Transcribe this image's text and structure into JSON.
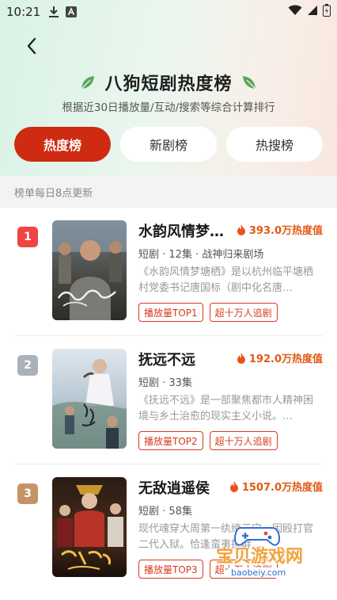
{
  "status_bar": {
    "time": "10:21",
    "icons": [
      "download-icon",
      "text-a-icon",
      "wifi-icon",
      "signal-icon",
      "battery-charging-icon"
    ]
  },
  "header": {
    "title": "八狗短剧热度榜",
    "subtitle": "根据近30日播放量/互动/搜索等综合计算排行",
    "accent_color": "#cf2a12"
  },
  "tabs": [
    {
      "label": "热度榜",
      "active": true
    },
    {
      "label": "新剧榜",
      "active": false
    },
    {
      "label": "热搜榜",
      "active": false
    }
  ],
  "update_note": "榜单每日8点更新",
  "items": [
    {
      "rank": "1",
      "rank_color": "#f04343",
      "title": "水韵风情梦塘栖",
      "heat": "393.0万热度值",
      "meta": "短剧 · 12集 · 战神归来剧场",
      "desc": "《水韵风情梦塘栖》是以杭州临平塘栖村党委书记唐国标（剧中化名唐…",
      "tags": [
        "播放量TOP1",
        "超十万人追剧"
      ]
    },
    {
      "rank": "2",
      "rank_color": "#a9b1bb",
      "title": "抚远不远",
      "heat": "192.0万热度值",
      "meta": "短剧 · 33集",
      "desc": "《抚远不远》是一部聚焦都市人精神困境与乡土治愈的现实主义小说。…",
      "tags": [
        "播放量TOP2",
        "超十万人追剧"
      ]
    },
    {
      "rank": "3",
      "rank_color": "#c59466",
      "title": "无敌逍遥侯",
      "heat": "1507.0万热度值",
      "meta": "短剧 · 58集",
      "desc": "现代魂穿大周第一纨绔三宁，因殴打官二代入狱。恰逢蛮夷挑衅…",
      "tags": [
        "播放量TOP3",
        "超十万人追剧"
      ]
    }
  ],
  "watermark": {
    "text": "宝贝游戏网",
    "url": "baobeiy.com"
  }
}
